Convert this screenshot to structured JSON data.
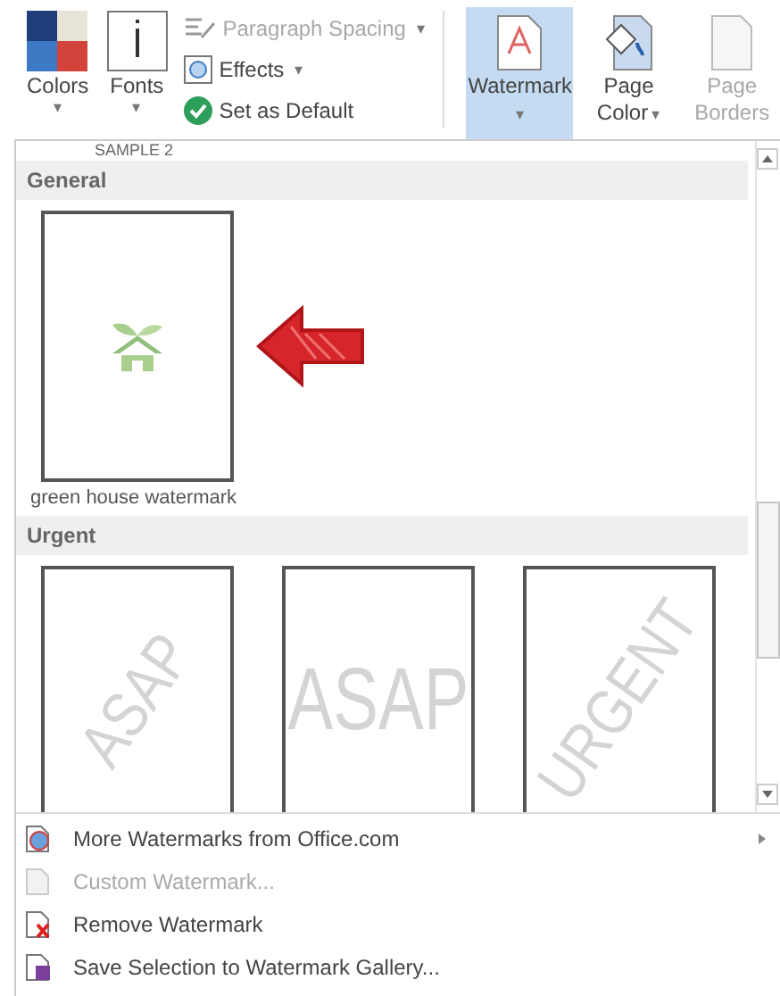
{
  "ribbon": {
    "theme_buttons": [
      {
        "kind": "colors",
        "label": "Colors",
        "caret": "▾"
      },
      {
        "kind": "fonts",
        "label": "Fonts",
        "caret": "▾"
      }
    ],
    "format_items": [
      {
        "kind": "spacing",
        "label": "Paragraph Spacing",
        "caret": "▾",
        "disabled": true
      },
      {
        "kind": "effects",
        "label": "Effects",
        "caret": "▾",
        "disabled": false
      },
      {
        "kind": "default",
        "label": "Set as Default",
        "disabled": false
      }
    ],
    "background_buttons": [
      {
        "kind": "watermark",
        "label": "Watermark",
        "caret": "▾",
        "selected": true,
        "disabled": false
      },
      {
        "kind": "page-color",
        "label": "Page",
        "second_line": "Color",
        "caret": "▾",
        "selected": false,
        "disabled": false
      },
      {
        "kind": "page-borders",
        "label": "Page",
        "second_line": "Borders",
        "selected": false,
        "disabled": true
      }
    ]
  },
  "gallery": {
    "top_label": "SAMPLE 2",
    "sections": [
      {
        "title": "General",
        "items": [
          {
            "kind": "picture",
            "caption": "green house watermark",
            "annotated": true
          }
        ]
      },
      {
        "title": "Urgent",
        "items": [
          {
            "kind": "text",
            "text": "ASAP",
            "diagonal": true
          },
          {
            "kind": "text",
            "text": "ASAP",
            "diagonal": false
          },
          {
            "kind": "text",
            "text": "URGENT",
            "diagonal": true
          }
        ]
      }
    ]
  },
  "menu": [
    {
      "kind": "more",
      "label": "More Watermarks from Office.com",
      "disabled": false,
      "submenu": true
    },
    {
      "kind": "custom",
      "label": "Custom Watermark...",
      "disabled": true,
      "submenu": false
    },
    {
      "kind": "remove",
      "label": "Remove Watermark",
      "disabled": false,
      "submenu": false
    },
    {
      "kind": "save",
      "label": "Save Selection to Watermark Gallery...",
      "disabled": false,
      "submenu": false
    }
  ]
}
